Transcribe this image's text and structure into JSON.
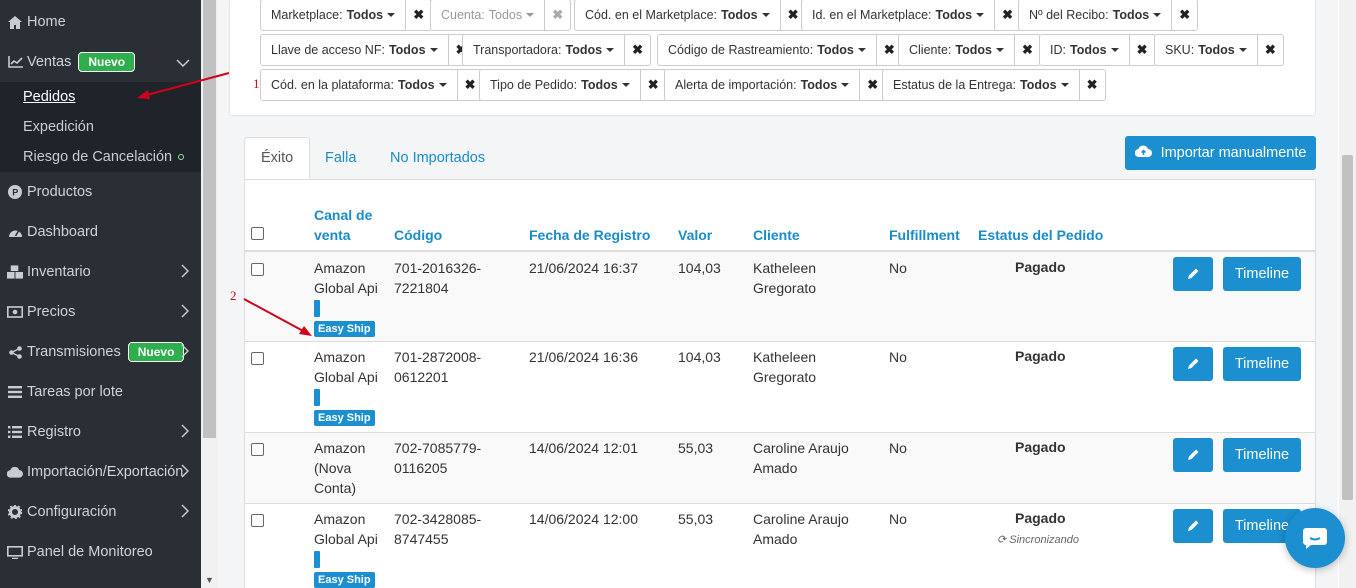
{
  "sidebar": {
    "items": [
      {
        "label": "Home",
        "icon": "home-icon"
      },
      {
        "label": "Ventas",
        "badge": "Nuevo",
        "icon": "chart-line-icon"
      },
      {
        "label": "Productos",
        "icon": "product-icon"
      },
      {
        "label": "Dashboard",
        "icon": "dashboard-icon"
      },
      {
        "label": "Inventario",
        "icon": "cubes-icon"
      },
      {
        "label": "Precios",
        "icon": "money-icon"
      },
      {
        "label": "Transmisiones",
        "badge": "Nuevo",
        "icon": "share-icon"
      },
      {
        "label": "Tareas por lote",
        "icon": "list-icon"
      },
      {
        "label": "Registro",
        "icon": "registry-list-icon"
      },
      {
        "label": "Importación/Exportación",
        "icon": "cloud-icon"
      },
      {
        "label": "Configuración",
        "icon": "gear-icon"
      },
      {
        "label": "Panel de Monitoreo",
        "icon": "monitor-icon"
      }
    ],
    "ventas_sub": [
      {
        "label": "Pedidos",
        "active": true
      },
      {
        "label": "Expedición"
      },
      {
        "label": "Riesgo de Cancelación"
      }
    ]
  },
  "filters": [
    {
      "label": "Marketplace:",
      "value": "Todos"
    },
    {
      "label": "Cuenta:",
      "value": "Todos",
      "disabled": true
    },
    {
      "label": "Cód. en el Marketplace:",
      "value": "Todos"
    },
    {
      "label": "Id. en el Marketplace:",
      "value": "Todos"
    },
    {
      "label": "Nº del Recibo:",
      "value": "Todos"
    },
    {
      "label": "Llave de acceso NF:",
      "value": "Todos"
    },
    {
      "label": "Transportadora:",
      "value": "Todos"
    },
    {
      "label": "Código de Rastreamiento:",
      "value": "Todos"
    },
    {
      "label": "Cliente:",
      "value": "Todos"
    },
    {
      "label": "ID:",
      "value": "Todos"
    },
    {
      "label": "SKU:",
      "value": "Todos"
    },
    {
      "label": "Cód. en la plataforma:",
      "value": "Todos"
    },
    {
      "label": "Tipo de Pedido:",
      "value": "Todos"
    },
    {
      "label": "Alerta de importación:",
      "value": "Todos"
    },
    {
      "label": "Estatus de la Entrega:",
      "value": "Todos"
    }
  ],
  "annotations": {
    "n1": "1",
    "n2": "2"
  },
  "tabs": [
    {
      "label": "Éxito",
      "active": true
    },
    {
      "label": "Falla"
    },
    {
      "label": "No Importados"
    }
  ],
  "import_button": "Importar manualmente",
  "table": {
    "headers": {
      "canal1": "Canal de",
      "canal2": "venta",
      "codigo": "Código",
      "fecha": "Fecha de Registro",
      "valor": "Valor",
      "cliente": "Cliente",
      "fulfillment": "Fulfillment",
      "estatus": "Estatus del Pedido"
    },
    "rows": [
      {
        "canal": [
          "Amazon",
          "Global Api"
        ],
        "tag": "Easy Ship",
        "codigo": [
          "701-2016326-",
          "7221804"
        ],
        "fecha": "21/06/2024 16:37",
        "valor": "104,03",
        "cliente": [
          "Katheleen",
          "Gregorato"
        ],
        "fulfillment": "No",
        "estatus": "Pagado"
      },
      {
        "canal": [
          "Amazon",
          "Global Api"
        ],
        "tag": "Easy Ship",
        "codigo": [
          "701-2872008-",
          "0612201"
        ],
        "fecha": "21/06/2024 16:36",
        "valor": "104,03",
        "cliente": [
          "Katheleen",
          "Gregorato"
        ],
        "fulfillment": "No",
        "estatus": "Pagado"
      },
      {
        "canal": [
          "Amazon",
          "(Nova",
          "Conta)"
        ],
        "codigo": [
          "702-7085779-",
          "0116205"
        ],
        "fecha": "14/06/2024 12:01",
        "valor": "55,03",
        "cliente": [
          "Caroline Araujo",
          "Amado"
        ],
        "fulfillment": "No",
        "estatus": "Pagado"
      },
      {
        "canal": [
          "Amazon",
          "Global Api"
        ],
        "tag": "Easy Ship",
        "codigo": [
          "702-3428085-",
          "8747455"
        ],
        "fecha": "14/06/2024 12:00",
        "valor": "55,03",
        "cliente": [
          "Caroline Araujo",
          "Amado"
        ],
        "fulfillment": "No",
        "estatus": "Pagado",
        "sync": "Sincronizando"
      }
    ],
    "timeline_label": "Timeline"
  },
  "colors": {
    "accent": "#1b8fcf",
    "sidebar": "#2a2f35",
    "badge": "#2fae4d",
    "annotation": "#d0021b"
  }
}
